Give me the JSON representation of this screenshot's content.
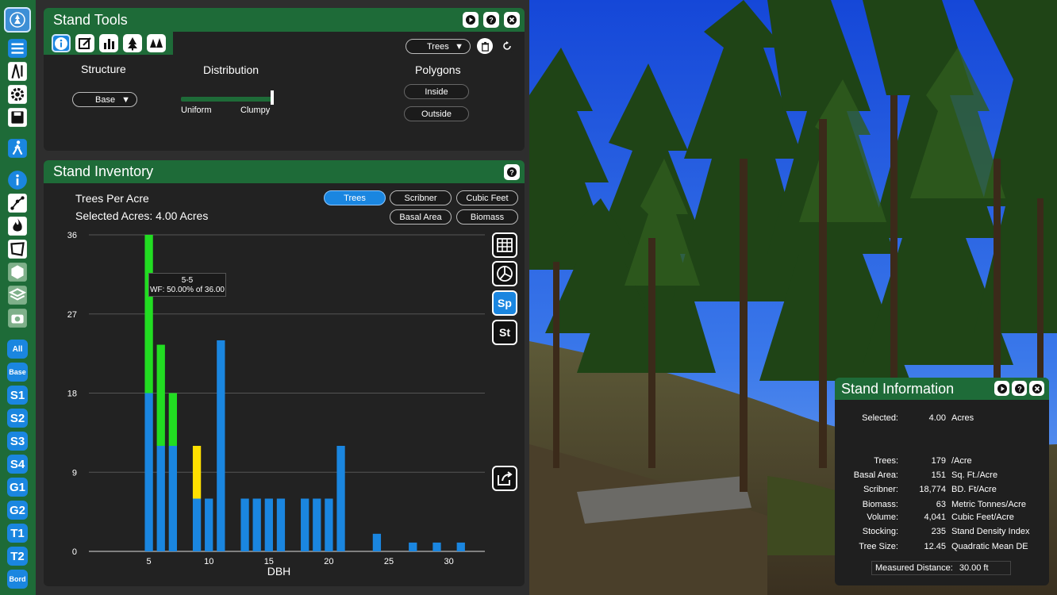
{
  "rail": {
    "chips": [
      {
        "label": "All"
      },
      {
        "label": "Base"
      },
      {
        "label": "S1"
      },
      {
        "label": "S2"
      },
      {
        "label": "S3"
      },
      {
        "label": "S4"
      },
      {
        "label": "G1"
      },
      {
        "label": "G2"
      },
      {
        "label": "T1"
      },
      {
        "label": "T2"
      },
      {
        "label": "Bord"
      }
    ]
  },
  "stand_tools": {
    "title": "Stand Tools",
    "species_select": "Trees",
    "structure_label": "Structure",
    "structure_select": "Base",
    "distribution_label": "Distribution",
    "distribution_min": "Uniform",
    "distribution_max": "Clumpy",
    "distribution_level": 1.0,
    "polygons_label": "Polygons",
    "inside_label": "Inside",
    "outside_label": "Outside"
  },
  "inventory": {
    "title": "Stand Inventory",
    "metric_label": "Trees Per Acre",
    "selected_acres": "Selected Acres: 4.00 Acres",
    "buttons": {
      "trees": "Trees",
      "scribner": "Scribner",
      "cubic_feet": "Cubic Feet",
      "basal_area": "Basal Area",
      "biomass": "Biomass"
    },
    "tooltip_line1": "5-5",
    "tooltip_line2": "WF: 50.00% of 36.00",
    "side_tools": {
      "sp": "Sp",
      "st": "St"
    }
  },
  "chart_data": {
    "type": "bar",
    "stacked": true,
    "xlabel": "DBH",
    "ylabel": "",
    "xlim": [
      0,
      33
    ],
    "ylim": [
      0,
      36
    ],
    "xticks": [
      5,
      10,
      15,
      20,
      25,
      30
    ],
    "yticks": [
      0,
      9,
      18,
      27,
      36
    ],
    "grid": true,
    "x": [
      5,
      6,
      7,
      9,
      10,
      11,
      13,
      14,
      15,
      16,
      18,
      19,
      20,
      21,
      24,
      27,
      29,
      31
    ],
    "series": [
      {
        "color": "#1a86e0",
        "values": [
          18,
          12,
          12,
          6,
          6,
          24,
          6,
          6,
          6,
          6,
          6,
          6,
          6,
          12,
          2,
          1,
          1,
          1
        ]
      },
      {
        "color": "#ffe000",
        "values": [
          0,
          0,
          0,
          6,
          0,
          0,
          0,
          0,
          0,
          0,
          0,
          0,
          0,
          0,
          0,
          0,
          0,
          0
        ]
      },
      {
        "color": "#22dd22",
        "values": [
          18,
          11.5,
          6,
          0,
          0,
          0,
          0,
          0,
          0,
          0,
          0,
          0,
          0,
          0,
          0,
          0,
          0,
          0
        ]
      }
    ]
  },
  "stand_info": {
    "title": "Stand Information",
    "rows": [
      {
        "label": "Selected:",
        "value": "4.00",
        "unit": "Acres"
      },
      {
        "label": "Trees:",
        "value": "179",
        "unit": "/Acre"
      },
      {
        "label": "Basal Area:",
        "value": "151",
        "unit": "Sq. Ft./Acre"
      },
      {
        "label": "Scribner:",
        "value": "18,774",
        "unit": "BD. Ft/Acre"
      },
      {
        "label": "Biomass:",
        "value": "63",
        "unit": "Metric Tonnes/Acre"
      },
      {
        "label": "Volume:",
        "value": "4,041",
        "unit": "Cubic Feet/Acre"
      },
      {
        "label": "Stocking:",
        "value": "235",
        "unit": "Stand Density Index"
      },
      {
        "label": "Tree Size:",
        "value": "12.45",
        "unit": "Quadratic Mean DE"
      }
    ],
    "measured_label": "Measured Distance:",
    "measured_value": "30.00 ft"
  },
  "colors": {
    "panel_green": "#1e6b38",
    "accent_blue": "#1a86e0"
  }
}
